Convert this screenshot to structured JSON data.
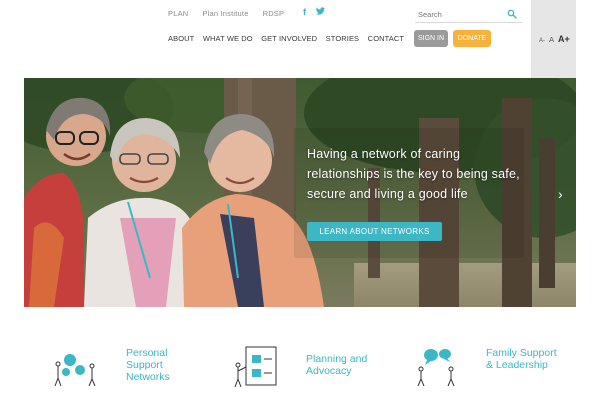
{
  "header": {
    "util_links": [
      "PLAN",
      "Plan Institute",
      "RDSP"
    ],
    "social": {
      "facebook": "f",
      "twitter": "t"
    },
    "search_placeholder": "Search",
    "nav": [
      "ABOUT",
      "WHAT WE DO",
      "GET INVOLVED",
      "STORIES",
      "CONTACT"
    ],
    "signin_label": "SIGN IN",
    "donate_label": "DONATE",
    "font_sizes": {
      "small": "A-",
      "medium": "A",
      "large": "A+"
    }
  },
  "hero": {
    "headline": "Having a network of caring relationships is the key to being safe, secure and living a good life",
    "cta_label": "LEARN ABOUT NETWORKS",
    "next_arrow": "›"
  },
  "features": [
    {
      "label": "Personal Support Networks",
      "icon": "network-gears-icon"
    },
    {
      "label": "Planning and Advocacy",
      "icon": "checklist-person-icon"
    },
    {
      "label": "Family Support & Leadership",
      "icon": "speech-bubbles-people-icon"
    }
  ],
  "colors": {
    "accent": "#3bb7c6",
    "donate": "#f7b23b",
    "signin": "#9a9a9a"
  }
}
